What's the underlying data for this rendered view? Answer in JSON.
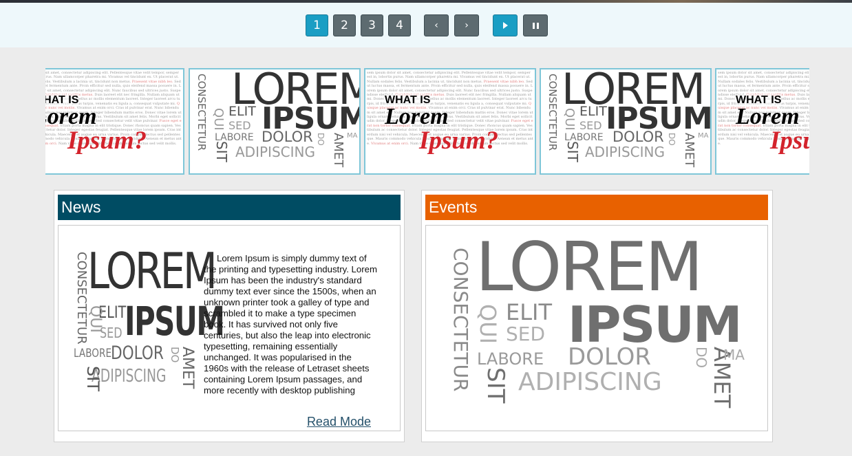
{
  "controls": {
    "pages": [
      "1",
      "2",
      "3",
      "4"
    ],
    "active_page": "1",
    "prev_label": "‹",
    "next_label": "›"
  },
  "carousel": {
    "slides": [
      {
        "type": "what-is",
        "heading": "WHAT IS",
        "word1": "Lorem",
        "word2": "Ipsum?"
      },
      {
        "type": "word-cloud"
      },
      {
        "type": "what-is",
        "heading": "WHAT IS",
        "word1": "Lorem",
        "word2": "Ipsum?"
      },
      {
        "type": "word-cloud"
      },
      {
        "type": "what-is",
        "heading": "WHAT IS",
        "word1": "Lorem",
        "word2": "Ipsum?"
      }
    ]
  },
  "word_cloud": [
    "LOREM",
    "IPSUM",
    "CONSECTETUR",
    "ELIT",
    "SED",
    "QUI",
    "LABORE",
    "DOLOR",
    "DO",
    "AMET",
    "MA",
    "ADIPISCING",
    "SIT"
  ],
  "news": {
    "title": "News",
    "body": "Lorem Ipsum is simply dummy text of the printing and typesetting industry. Lorem Ipsum has been the industry's standard dummy text ever since the 1500s, when an unknown printer took a galley of type and scrambled it to make a type specimen book. It has survived not only five centuries, but also the leap into electronic typesetting, remaining essentially unchanged. It was popularised in the 1960s with the release of Letraset sheets containing Lorem Ipsum passages, and more recently with desktop publishing",
    "read_more": "Read Mode"
  },
  "events": {
    "title": "Events"
  },
  "colors": {
    "news_header": "#004c63",
    "events_header": "#e86100",
    "active_button": "#1a9ec4",
    "inactive_button": "#5d6b70",
    "thumb_border": "#7ec6d8"
  }
}
